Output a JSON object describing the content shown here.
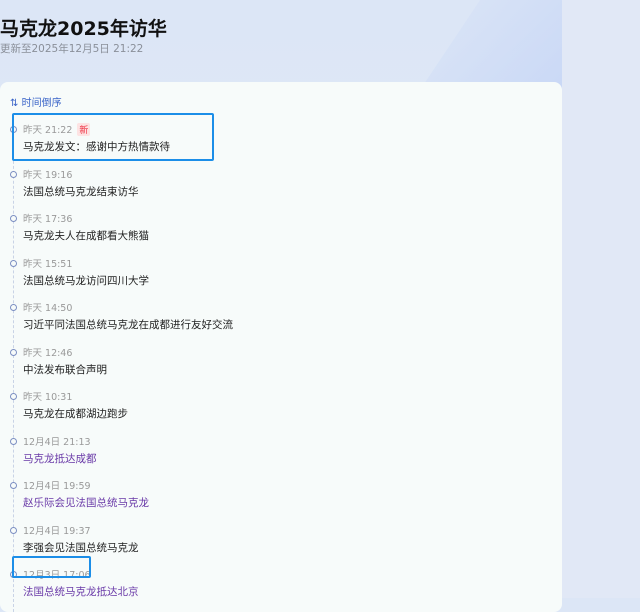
{
  "header": {
    "title": "马克龙2025年访华",
    "updated": "更新至2025年12月5日 21:22"
  },
  "sort": {
    "icon": "sort-icon",
    "label": "时间倒序"
  },
  "items": [
    {
      "time": "昨天 21:22",
      "badge": "新",
      "title": "马克龙发文：感谢中方热情款待",
      "visited": false
    },
    {
      "time": "昨天 19:16",
      "title": "法国总统马克龙结束访华",
      "visited": false
    },
    {
      "time": "昨天 17:36",
      "title": "马克龙夫人在成都看大熊猫",
      "visited": false
    },
    {
      "time": "昨天 15:51",
      "title": "法国总统马龙访问四川大学",
      "visited": false
    },
    {
      "time": "昨天 14:50",
      "title": "习近平同法国总统马克龙在成都进行友好交流",
      "visited": false
    },
    {
      "time": "昨天 12:46",
      "title": "中法发布联合声明",
      "visited": false
    },
    {
      "time": "昨天 10:31",
      "title": "马克龙在成都湖边跑步",
      "visited": false
    },
    {
      "time": "12月4日 21:13",
      "title": "马克龙抵达成都",
      "visited": true
    },
    {
      "time": "12月4日 19:59",
      "title": "赵乐际会见法国总统马克龙",
      "visited": true
    },
    {
      "time": "12月4日 19:37",
      "title": "李强会见法国总统马克龙",
      "visited": false
    },
    {
      "time": "12月3日 17:06",
      "title": "法国总统马克龙抵达北京",
      "visited": true
    }
  ],
  "colors": {
    "accent": "#3a64c8",
    "highlight": "#1c8ee8",
    "visited": "#6a3aa8",
    "badge": "#e34444"
  }
}
